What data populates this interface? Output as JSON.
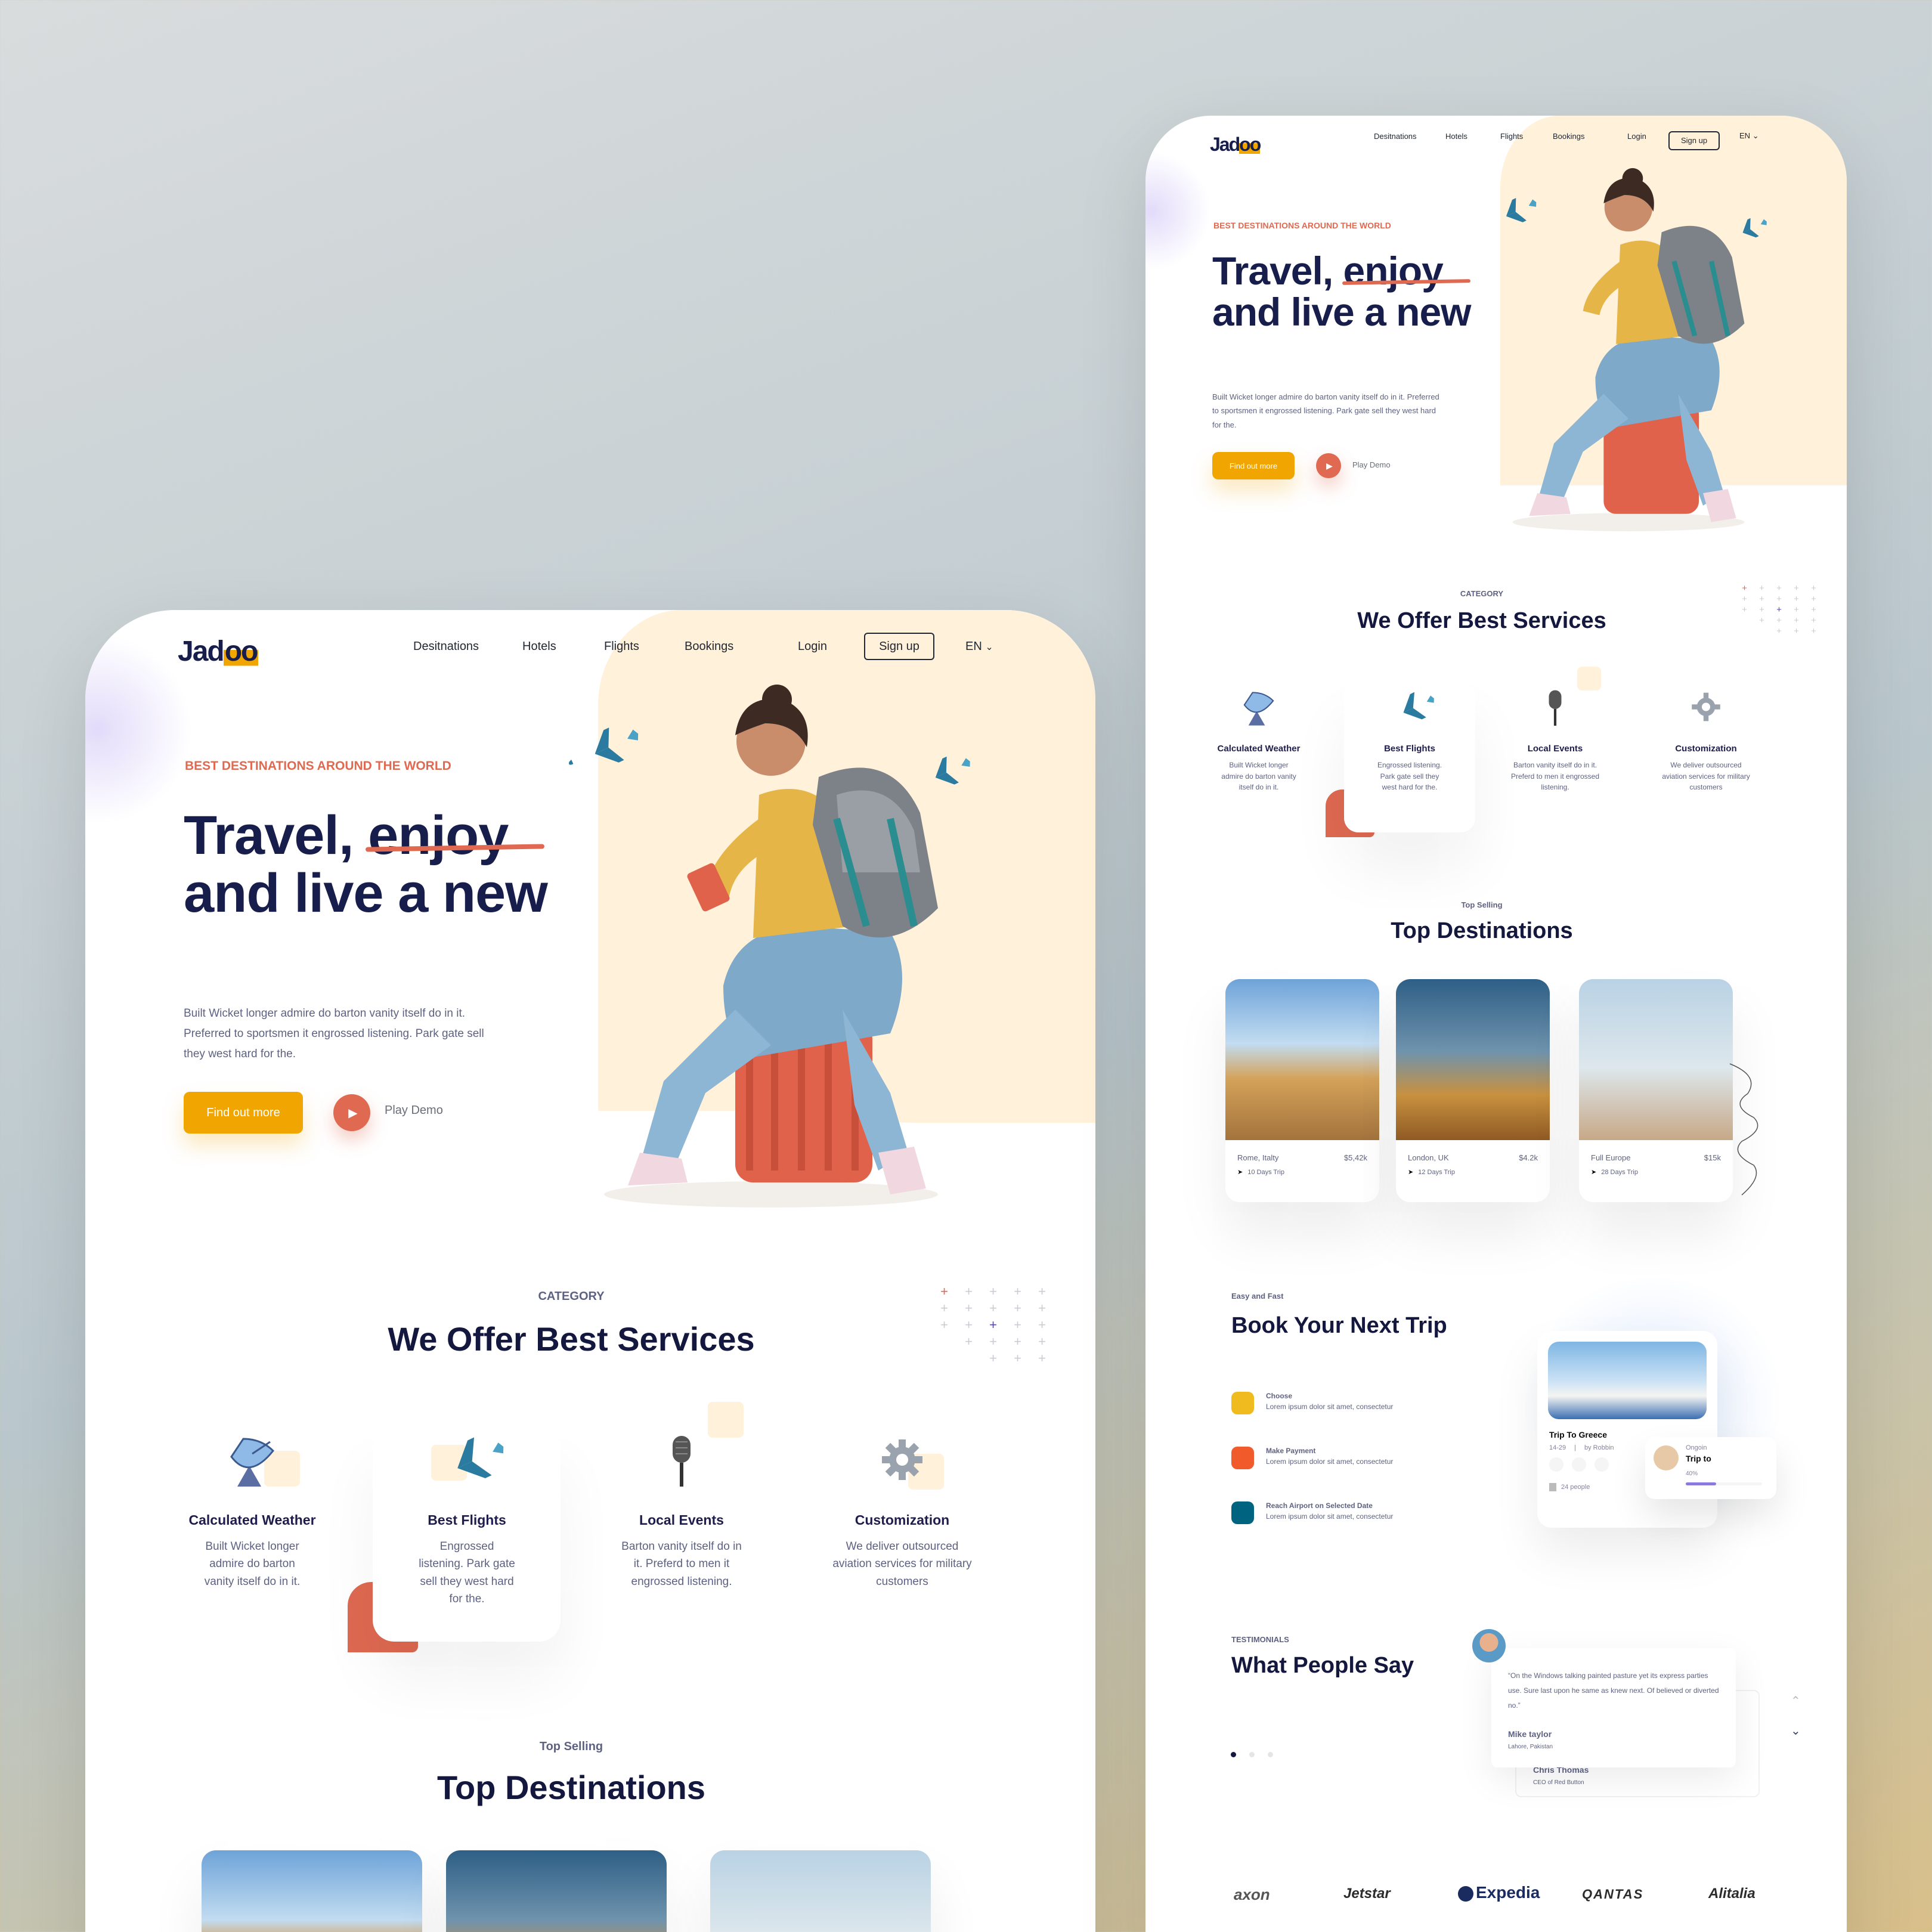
{
  "brand": {
    "name": "Jadoo",
    "name_prefix": "Jad",
    "name_suffix": "oo"
  },
  "nav": {
    "items": [
      "Desitnations",
      "Hotels",
      "Flights",
      "Bookings",
      "Login"
    ],
    "signup": "Sign up",
    "language": "EN",
    "language_chevron": "⌄"
  },
  "hero": {
    "eyebrow": "BEST DESTINATIONS AROUND THE WORLD",
    "title_line1": "Travel, enjoy",
    "title_line2": "and live a new",
    "description": "Built Wicket longer admire do barton vanity itself do in it. Preferred to sportsmen it engrossed listening. Park gate sell they west hard for the.",
    "cta": "Find out more",
    "play": "Play Demo"
  },
  "services": {
    "subtitle": "CATEGORY",
    "title": "We Offer Best Services",
    "items": [
      {
        "title": "Calculated Weather",
        "desc": "Built Wicket longer admire do barton vanity itself do in it.",
        "icon": "satellite-dish-icon"
      },
      {
        "title": "Best Flights",
        "desc": "Engrossed listening. Park gate sell they west hard for the.",
        "icon": "airplane-icon"
      },
      {
        "title": "Local Events",
        "desc": "Barton vanity itself do in it. Preferd to men it engrossed listening.",
        "icon": "microphone-icon"
      },
      {
        "title": "Customization",
        "desc": "We deliver outsourced aviation services for military customers",
        "icon": "gear-icon"
      }
    ]
  },
  "destinations": {
    "subtitle": "Top Selling",
    "title": "Top Destinations",
    "items": [
      {
        "place": "Rome, Italty",
        "price": "$5,42k",
        "duration": "10 Days Trip"
      },
      {
        "place": "London, UK",
        "price": "$4.2k",
        "duration": "12 Days Trip"
      },
      {
        "place": "Full Europe",
        "price": "$15k",
        "duration": "28 Days Trip"
      }
    ]
  },
  "booking": {
    "subtitle": "Easy and Fast",
    "title": "Book Your Next Trip",
    "steps": [
      {
        "title": "Choose",
        "desc": "Lorem ipsum dolor sit amet, consectetur",
        "color": "#f0bb1f"
      },
      {
        "title": "Make Payment",
        "desc": "Lorem ipsum dolor sit amet, consectetur",
        "color": "#f15a2b"
      },
      {
        "title": "Reach Airport on Selected Date",
        "desc": "Lorem ipsum dolor sit amet, consectetur",
        "color": "#006380"
      }
    ],
    "trip_card": {
      "title": "Trip To Greece",
      "dates": "14-29",
      "separator": "|",
      "author": "by Robbin",
      "people": "24 people",
      "ongoing_label": "Ongoin",
      "ongoing_title": "Trip to",
      "progress_text": "40%",
      "progress": 0.4
    }
  },
  "testimonials": {
    "subtitle": "TESTIMONIALS",
    "title": "What People Say",
    "quote": "“On the Windows talking painted pasture yet its express parties use. Sure last upon he same as knew next. Of believed or diverted no.”",
    "name": "Mike taylor",
    "location": "Lahore, Pakistan",
    "name2": "Chris Thomas",
    "role2": "CEO of Red Button",
    "arrow_up": "⌃",
    "arrow_down": "⌄"
  },
  "partners": [
    "axon",
    "Jetstar",
    "Expedia",
    "QANTAS",
    "Alitalia"
  ],
  "colors": {
    "accent": "#f1a501",
    "coral": "#df6951",
    "navy": "#181e4b",
    "cream": "#fff1da"
  }
}
